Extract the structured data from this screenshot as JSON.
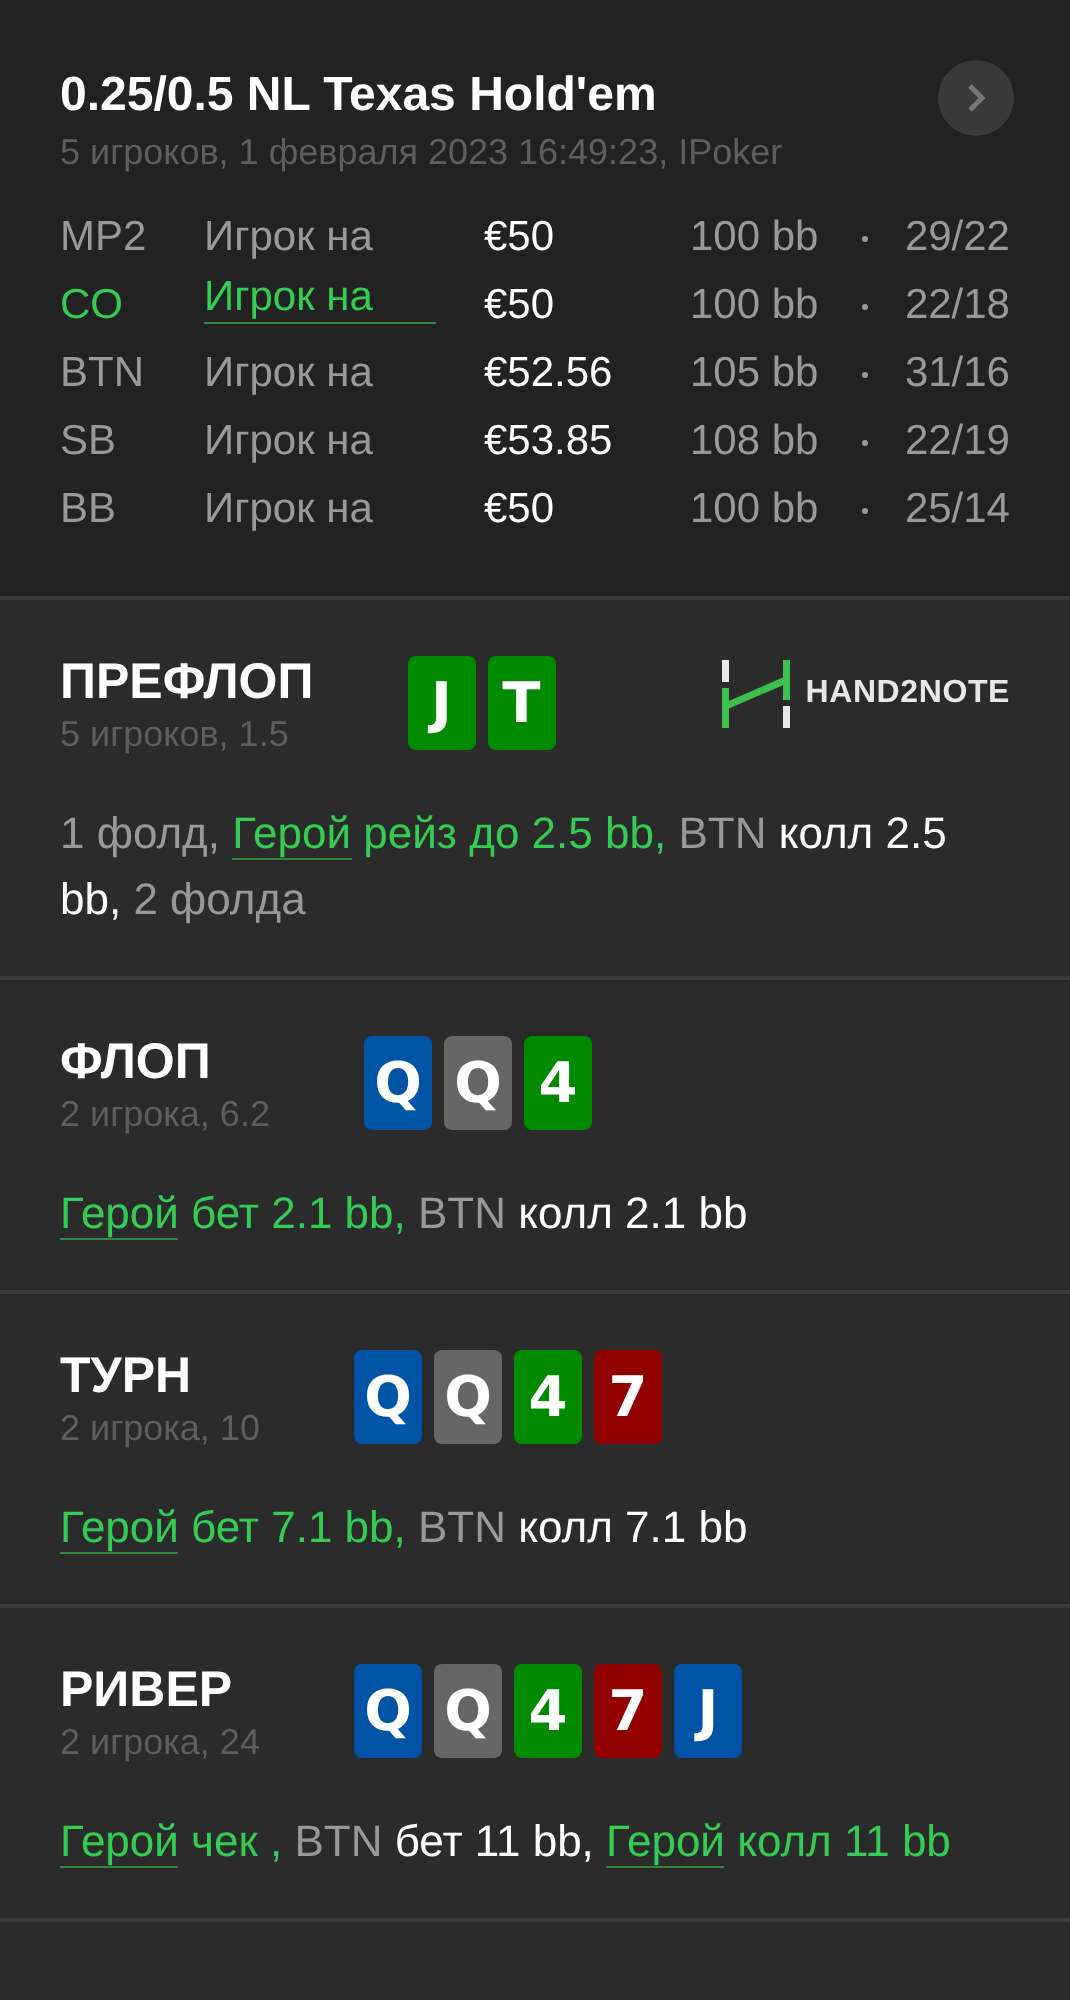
{
  "header": {
    "title": "0.25/0.5 NL Texas Hold'em",
    "info": "5 игроков, 1 февраля 2023 16:49:23, IPoker"
  },
  "players": [
    {
      "position": "MP2",
      "name": "Игрок на",
      "stack": "€50",
      "bb": "100 bb",
      "stats": "29/22",
      "hero": false
    },
    {
      "position": "CO",
      "name": "Игрок на",
      "stack": "€50",
      "bb": "100 bb",
      "stats": "22/18",
      "hero": true
    },
    {
      "position": "BTN",
      "name": "Игрок на",
      "stack": "€52.56",
      "bb": "105 bb",
      "stats": "31/16",
      "hero": false
    },
    {
      "position": "SB",
      "name": "Игрок на",
      "stack": "€53.85",
      "bb": "108 bb",
      "stats": "22/19",
      "hero": false
    },
    {
      "position": "BB",
      "name": "Игрок на",
      "stack": "€50",
      "bb": "100 bb",
      "stats": "25/14",
      "hero": false
    }
  ],
  "streets": [
    {
      "title": "ПРЕФЛОП",
      "info": "5 игроков, 1.5",
      "logo": {
        "text": "HAND2NOTE"
      },
      "cards": [
        {
          "rank": "J",
          "color": "#008a00"
        },
        {
          "rank": "T",
          "color": "#008a00"
        }
      ],
      "action": [
        {
          "kind": "muted",
          "text": "1 фолд, "
        },
        {
          "kind": "link",
          "text": "Герой"
        },
        {
          "kind": "hero",
          "text": " рейз до 2.5 bb, "
        },
        {
          "kind": "muted",
          "text": "BTN"
        },
        {
          "kind": "plain",
          "text": " колл 2.5 bb, "
        },
        {
          "kind": "muted",
          "text": "2 фолда"
        }
      ]
    },
    {
      "title": "ФЛОП",
      "info": "2 игрока, 6.2",
      "cards": [
        {
          "rank": "Q",
          "color": "#0054a6"
        },
        {
          "rank": "Q",
          "color": "#666666"
        },
        {
          "rank": "4",
          "color": "#008a00"
        }
      ],
      "action": [
        {
          "kind": "link",
          "text": "Герой"
        },
        {
          "kind": "hero",
          "text": " бет 2.1 bb, "
        },
        {
          "kind": "muted",
          "text": "BTN"
        },
        {
          "kind": "plain",
          "text": " колл 2.1 bb"
        }
      ]
    },
    {
      "title": "ТУРН",
      "info": "2 игрока, 10",
      "cards": [
        {
          "rank": "Q",
          "color": "#0054a6"
        },
        {
          "rank": "Q",
          "color": "#666666"
        },
        {
          "rank": "4",
          "color": "#008a00"
        },
        {
          "rank": "7",
          "color": "#930000"
        }
      ],
      "action": [
        {
          "kind": "link",
          "text": "Герой"
        },
        {
          "kind": "hero",
          "text": " бет 7.1 bb, "
        },
        {
          "kind": "muted",
          "text": "BTN"
        },
        {
          "kind": "plain",
          "text": " колл 7.1 bb"
        }
      ]
    },
    {
      "title": "РИВЕР",
      "info": "2 игрока, 24",
      "cards": [
        {
          "rank": "Q",
          "color": "#0054a6"
        },
        {
          "rank": "Q",
          "color": "#666666"
        },
        {
          "rank": "4",
          "color": "#008a00"
        },
        {
          "rank": "7",
          "color": "#930000"
        },
        {
          "rank": "J",
          "color": "#0054a6"
        }
      ],
      "action": [
        {
          "kind": "link",
          "text": "Герой"
        },
        {
          "kind": "hero",
          "text": " чек , "
        },
        {
          "kind": "muted",
          "text": "BTN"
        },
        {
          "kind": "plain",
          "text": " бет 11 bb, "
        },
        {
          "kind": "link",
          "text": "Герой"
        },
        {
          "kind": "hero",
          "text": " колл 11 bb"
        }
      ]
    }
  ]
}
